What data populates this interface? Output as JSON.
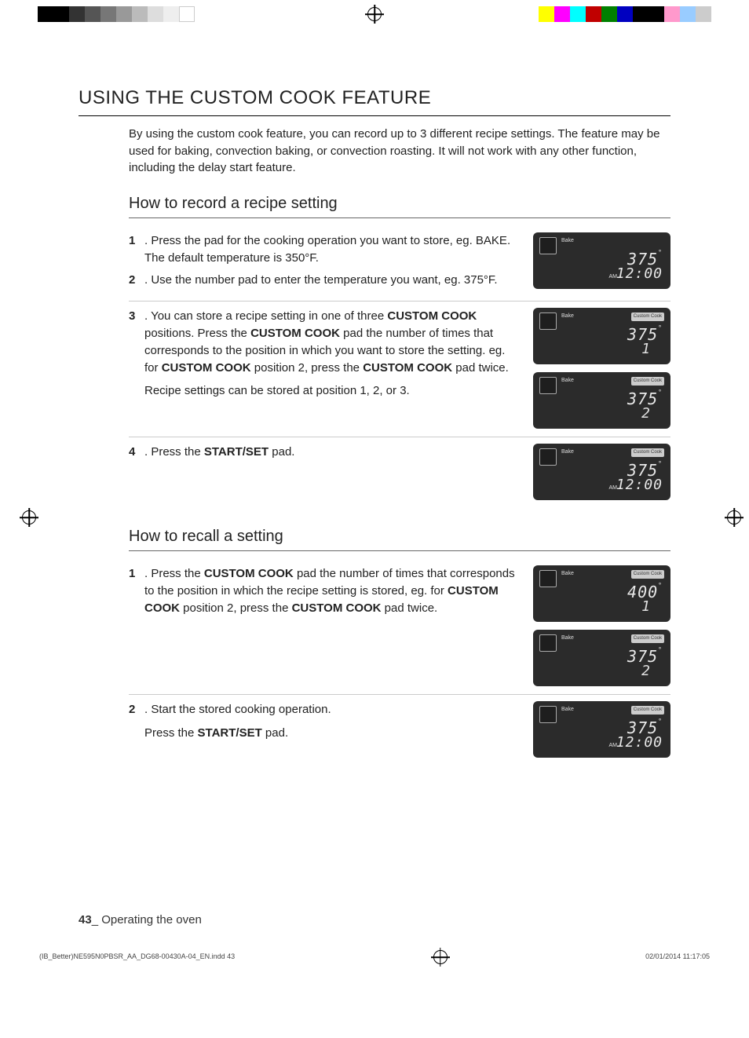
{
  "heading": "USING THE CUSTOM COOK FEATURE",
  "intro": "By using the custom cook feature, you can record up to 3 different recipe settings. The feature may be used for baking, convection baking, or convection roasting. It will not work with any other function, including the delay start feature.",
  "section_record": {
    "title": "How to record a recipe setting",
    "steps": {
      "s1": {
        "num": "1",
        "text": ". Press the pad for the cooking operation you want to store, eg. BAKE. The default temperature is 350°F."
      },
      "s2": {
        "num": "2",
        "text": ". Use the number pad to enter the temperature you want, eg. 375°F."
      },
      "s3": {
        "num": "3",
        "pre": ". You can store a recipe setting in one of three ",
        "b1": "CUSTOM COOK",
        "mid1": " positions. Press the ",
        "b2": "CUSTOM COOK",
        "mid2": " pad the number of times that corresponds to the position in which you want to store the setting. eg. for ",
        "b3": "CUSTOM COOK",
        "mid3": " position 2, press the ",
        "b4": "CUSTOM COOK",
        "post": " pad twice.",
        "sub": "Recipe settings can be stored at position 1, 2, or 3."
      },
      "s4": {
        "num": "4",
        "pre": ". Press the ",
        "b1": "START/SET",
        "post": " pad."
      }
    },
    "displays": {
      "d1": {
        "mode": "Bake",
        "temp": "375",
        "clock": "12:00",
        "ampm": "AM"
      },
      "d2": {
        "mode": "Bake",
        "badge": "Custom Cook",
        "temp": "375",
        "pos": "1"
      },
      "d3": {
        "mode": "Bake",
        "badge": "Custom Cook",
        "temp": "375",
        "pos": "2"
      },
      "d4": {
        "mode": "Bake",
        "badge": "Custom Cook",
        "temp": "375",
        "clock": "12:00",
        "ampm": "AM"
      }
    }
  },
  "section_recall": {
    "title": "How to recall a setting",
    "steps": {
      "s1": {
        "num": "1",
        "pre": ". Press the ",
        "b1": "CUSTOM COOK",
        "mid1": " pad the number of times that corresponds to the position in which the recipe setting is stored, eg. for ",
        "b2": "CUSTOM COOK",
        "mid2": " position 2, press the ",
        "b3": "CUSTOM COOK",
        "post": " pad twice."
      },
      "s2": {
        "num": "2",
        "text": ". Start the stored cooking operation.",
        "sub_pre": "Press the ",
        "sub_b": "START/SET",
        "sub_post": " pad."
      }
    },
    "displays": {
      "d1": {
        "mode": "Bake",
        "badge": "Custom Cook",
        "temp": "400",
        "pos": "1"
      },
      "d2": {
        "mode": "Bake",
        "badge": "Custom Cook",
        "temp": "375",
        "pos": "2"
      },
      "d3": {
        "mode": "Bake",
        "badge": "Custom Cook",
        "temp": "375",
        "clock": "12:00",
        "ampm": "AM"
      }
    }
  },
  "footer": {
    "page_num": "43",
    "sep": "_",
    "section": " Operating the oven"
  },
  "doc_footer": {
    "file": "(IB_Better)NE595N0PBSR_AA_DG68-00430A-04_EN.indd   43",
    "date": "02/01/2014   11:17:05"
  },
  "deg": "°"
}
